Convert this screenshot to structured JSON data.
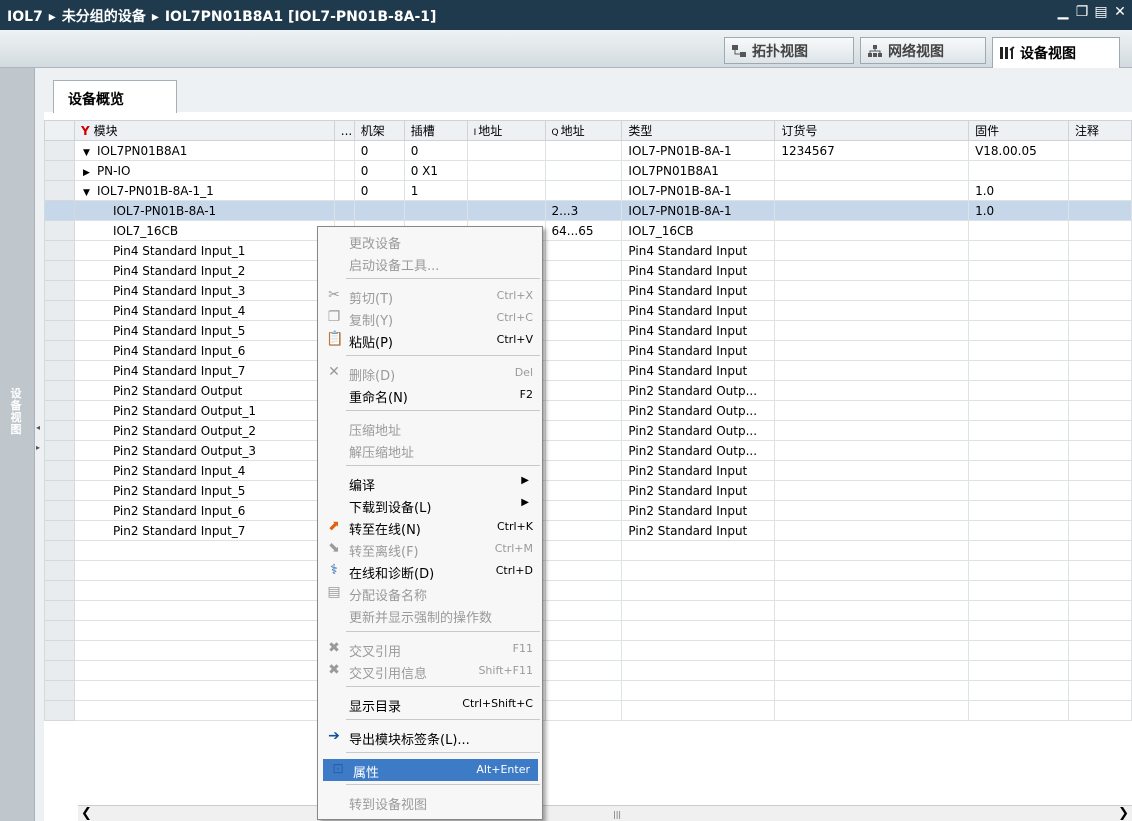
{
  "titlebar": {
    "crumbs": [
      "IOL7",
      "未分组的设备",
      "IOL7PN01B8A1 [IOL7-PN01B-8A-1]"
    ],
    "separator": "▸"
  },
  "view_tabs": [
    "拓扑视图",
    "网络视图",
    "设备视图"
  ],
  "left_panel": {
    "label": "设备视图"
  },
  "overview_tab": "设备概览",
  "table": {
    "headers": [
      "模块",
      "...",
      "机架",
      "插槽",
      "I 地址",
      "Q 地址",
      "类型",
      "订货号",
      "固件",
      "注释"
    ],
    "i_prefix": "I",
    "q_prefix": "Q",
    "i_header": "地址",
    "q_header": "地址",
    "rows": [
      {
        "expand": "▼",
        "module": "IOL7PN01B8A1",
        "rack": "0",
        "slot": "0",
        "iaddr": "",
        "qaddr": "",
        "type": "IOL7-PN01B-8A-1",
        "order": "1234567",
        "fw": "V18.00.05"
      },
      {
        "expand": "▶",
        "module": "PN-IO",
        "rack": "0",
        "slot": "0 X1",
        "iaddr": "",
        "qaddr": "",
        "type": "IOL7PN01B8A1",
        "order": "",
        "fw": ""
      },
      {
        "expand": "▼",
        "module": "IOL7-PN01B-8A-1_1",
        "rack": "0",
        "slot": "1",
        "iaddr": "",
        "qaddr": "",
        "type": "IOL7-PN01B-8A-1",
        "order": "",
        "fw": "1.0"
      },
      {
        "expand": "",
        "module": "IOL7-PN01B-8A-1",
        "rack": "",
        "slot": "",
        "iaddr": "",
        "qaddr": "2...3",
        "type": "IOL7-PN01B-8A-1",
        "order": "",
        "fw": "1.0",
        "selected": true
      },
      {
        "expand": "",
        "module": "IOL7_16CB",
        "rack": "",
        "slot": "",
        "iaddr": "",
        "qaddr": "64...65",
        "type": "IOL7_16CB",
        "order": "",
        "fw": ""
      },
      {
        "expand": "",
        "module": "Pin4 Standard Input_1",
        "rack": "",
        "slot": "",
        "iaddr": "",
        "qaddr": "",
        "type": "Pin4 Standard Input",
        "order": "",
        "fw": ""
      },
      {
        "expand": "",
        "module": "Pin4 Standard Input_2",
        "rack": "",
        "slot": "",
        "iaddr": "",
        "qaddr": "",
        "type": "Pin4 Standard Input",
        "order": "",
        "fw": ""
      },
      {
        "expand": "",
        "module": "Pin4 Standard Input_3",
        "rack": "",
        "slot": "",
        "iaddr": "",
        "qaddr": "",
        "type": "Pin4 Standard Input",
        "order": "",
        "fw": ""
      },
      {
        "expand": "",
        "module": "Pin4 Standard Input_4",
        "rack": "",
        "slot": "",
        "iaddr": "",
        "qaddr": "",
        "type": "Pin4 Standard Input",
        "order": "",
        "fw": ""
      },
      {
        "expand": "",
        "module": "Pin4 Standard Input_5",
        "rack": "",
        "slot": "",
        "iaddr": "",
        "qaddr": "",
        "type": "Pin4 Standard Input",
        "order": "",
        "fw": ""
      },
      {
        "expand": "",
        "module": "Pin4 Standard Input_6",
        "rack": "",
        "slot": "",
        "iaddr": "",
        "qaddr": "",
        "type": "Pin4 Standard Input",
        "order": "",
        "fw": ""
      },
      {
        "expand": "",
        "module": "Pin4 Standard Input_7",
        "rack": "",
        "slot": "",
        "iaddr": "",
        "qaddr": "",
        "type": "Pin4 Standard Input",
        "order": "",
        "fw": ""
      },
      {
        "expand": "",
        "module": "Pin2 Standard Output",
        "rack": "",
        "slot": "",
        "iaddr": "",
        "qaddr": "",
        "type": "Pin2 Standard Outp...",
        "order": "",
        "fw": ""
      },
      {
        "expand": "",
        "module": "Pin2 Standard Output_1",
        "rack": "",
        "slot": "",
        "iaddr": "",
        "qaddr": "",
        "type": "Pin2 Standard Outp...",
        "order": "",
        "fw": ""
      },
      {
        "expand": "",
        "module": "Pin2 Standard Output_2",
        "rack": "",
        "slot": "",
        "iaddr": "",
        "qaddr": "",
        "type": "Pin2 Standard Outp...",
        "order": "",
        "fw": ""
      },
      {
        "expand": "",
        "module": "Pin2 Standard Output_3",
        "rack": "",
        "slot": "",
        "iaddr": "",
        "qaddr": "",
        "type": "Pin2 Standard Outp...",
        "order": "",
        "fw": ""
      },
      {
        "expand": "",
        "module": "Pin2 Standard Input_4",
        "rack": "",
        "slot": "",
        "iaddr": "",
        "qaddr": "",
        "type": "Pin2 Standard Input",
        "order": "",
        "fw": ""
      },
      {
        "expand": "",
        "module": "Pin2 Standard Input_5",
        "rack": "",
        "slot": "",
        "iaddr": "",
        "qaddr": "",
        "type": "Pin2 Standard Input",
        "order": "",
        "fw": ""
      },
      {
        "expand": "",
        "module": "Pin2 Standard Input_6",
        "rack": "",
        "slot": "",
        "iaddr": "",
        "qaddr": "",
        "type": "Pin2 Standard Input",
        "order": "",
        "fw": ""
      },
      {
        "expand": "",
        "module": "Pin2 Standard Input_7",
        "rack": "",
        "slot": "",
        "iaddr": "",
        "qaddr": "",
        "type": "Pin2 Standard Input",
        "order": "",
        "fw": ""
      }
    ]
  },
  "context_menu": {
    "items": [
      {
        "label": "更改设备",
        "shortcut": "",
        "icon": "",
        "disabled": true
      },
      {
        "label": "启动设备工具...",
        "shortcut": "",
        "icon": "",
        "disabled": true
      },
      {
        "label": "剪切(T)",
        "shortcut": "Ctrl+X",
        "icon": "cut-icon",
        "disabled": true
      },
      {
        "label": "复制(Y)",
        "shortcut": "Ctrl+C",
        "icon": "copy-icon",
        "disabled": true
      },
      {
        "label": "粘贴(P)",
        "shortcut": "Ctrl+V",
        "icon": "paste-icon",
        "disabled": false
      },
      {
        "label": "删除(D)",
        "shortcut": "Del",
        "icon": "delete-icon",
        "disabled": true
      },
      {
        "label": "重命名(N)",
        "shortcut": "F2",
        "icon": "",
        "disabled": false
      },
      {
        "label": "压缩地址",
        "shortcut": "",
        "icon": "",
        "disabled": true
      },
      {
        "label": "解压缩地址",
        "shortcut": "",
        "icon": "",
        "disabled": true
      },
      {
        "label": "编译",
        "shortcut": "",
        "icon": "",
        "disabled": false,
        "submenu": true
      },
      {
        "label": "下载到设备(L)",
        "shortcut": "",
        "icon": "",
        "disabled": false,
        "submenu": true
      },
      {
        "label": "转至在线(N)",
        "shortcut": "Ctrl+K",
        "icon": "go-online-icon",
        "disabled": false
      },
      {
        "label": "转至离线(F)",
        "shortcut": "Ctrl+M",
        "icon": "go-offline-icon",
        "disabled": true
      },
      {
        "label": "在线和诊断(D)",
        "shortcut": "Ctrl+D",
        "icon": "diagnostics-icon",
        "disabled": false
      },
      {
        "label": "分配设备名称",
        "shortcut": "",
        "icon": "assign-name-icon",
        "disabled": true
      },
      {
        "label": "更新并显示强制的操作数",
        "shortcut": "",
        "icon": "",
        "disabled": true
      },
      {
        "label": "交叉引用",
        "shortcut": "F11",
        "icon": "cross-ref-icon",
        "disabled": true
      },
      {
        "label": "交叉引用信息",
        "shortcut": "Shift+F11",
        "icon": "cross-ref-info-icon",
        "disabled": true
      },
      {
        "label": "显示目录",
        "shortcut": "Ctrl+Shift+C",
        "icon": "",
        "disabled": false
      },
      {
        "label": "导出模块标签条(L)...",
        "shortcut": "",
        "icon": "export-icon",
        "disabled": false
      },
      {
        "label": "属性",
        "shortcut": "Alt+Enter",
        "icon": "properties-icon",
        "disabled": false,
        "highlighted": true
      },
      {
        "label": "转到设备视图",
        "shortcut": "",
        "icon": "",
        "disabled": true
      }
    ]
  },
  "colors": {
    "title_bg": "#1f3a4d",
    "selection": "#c7d7ea",
    "menu_highlight": "#3d7bc6"
  }
}
